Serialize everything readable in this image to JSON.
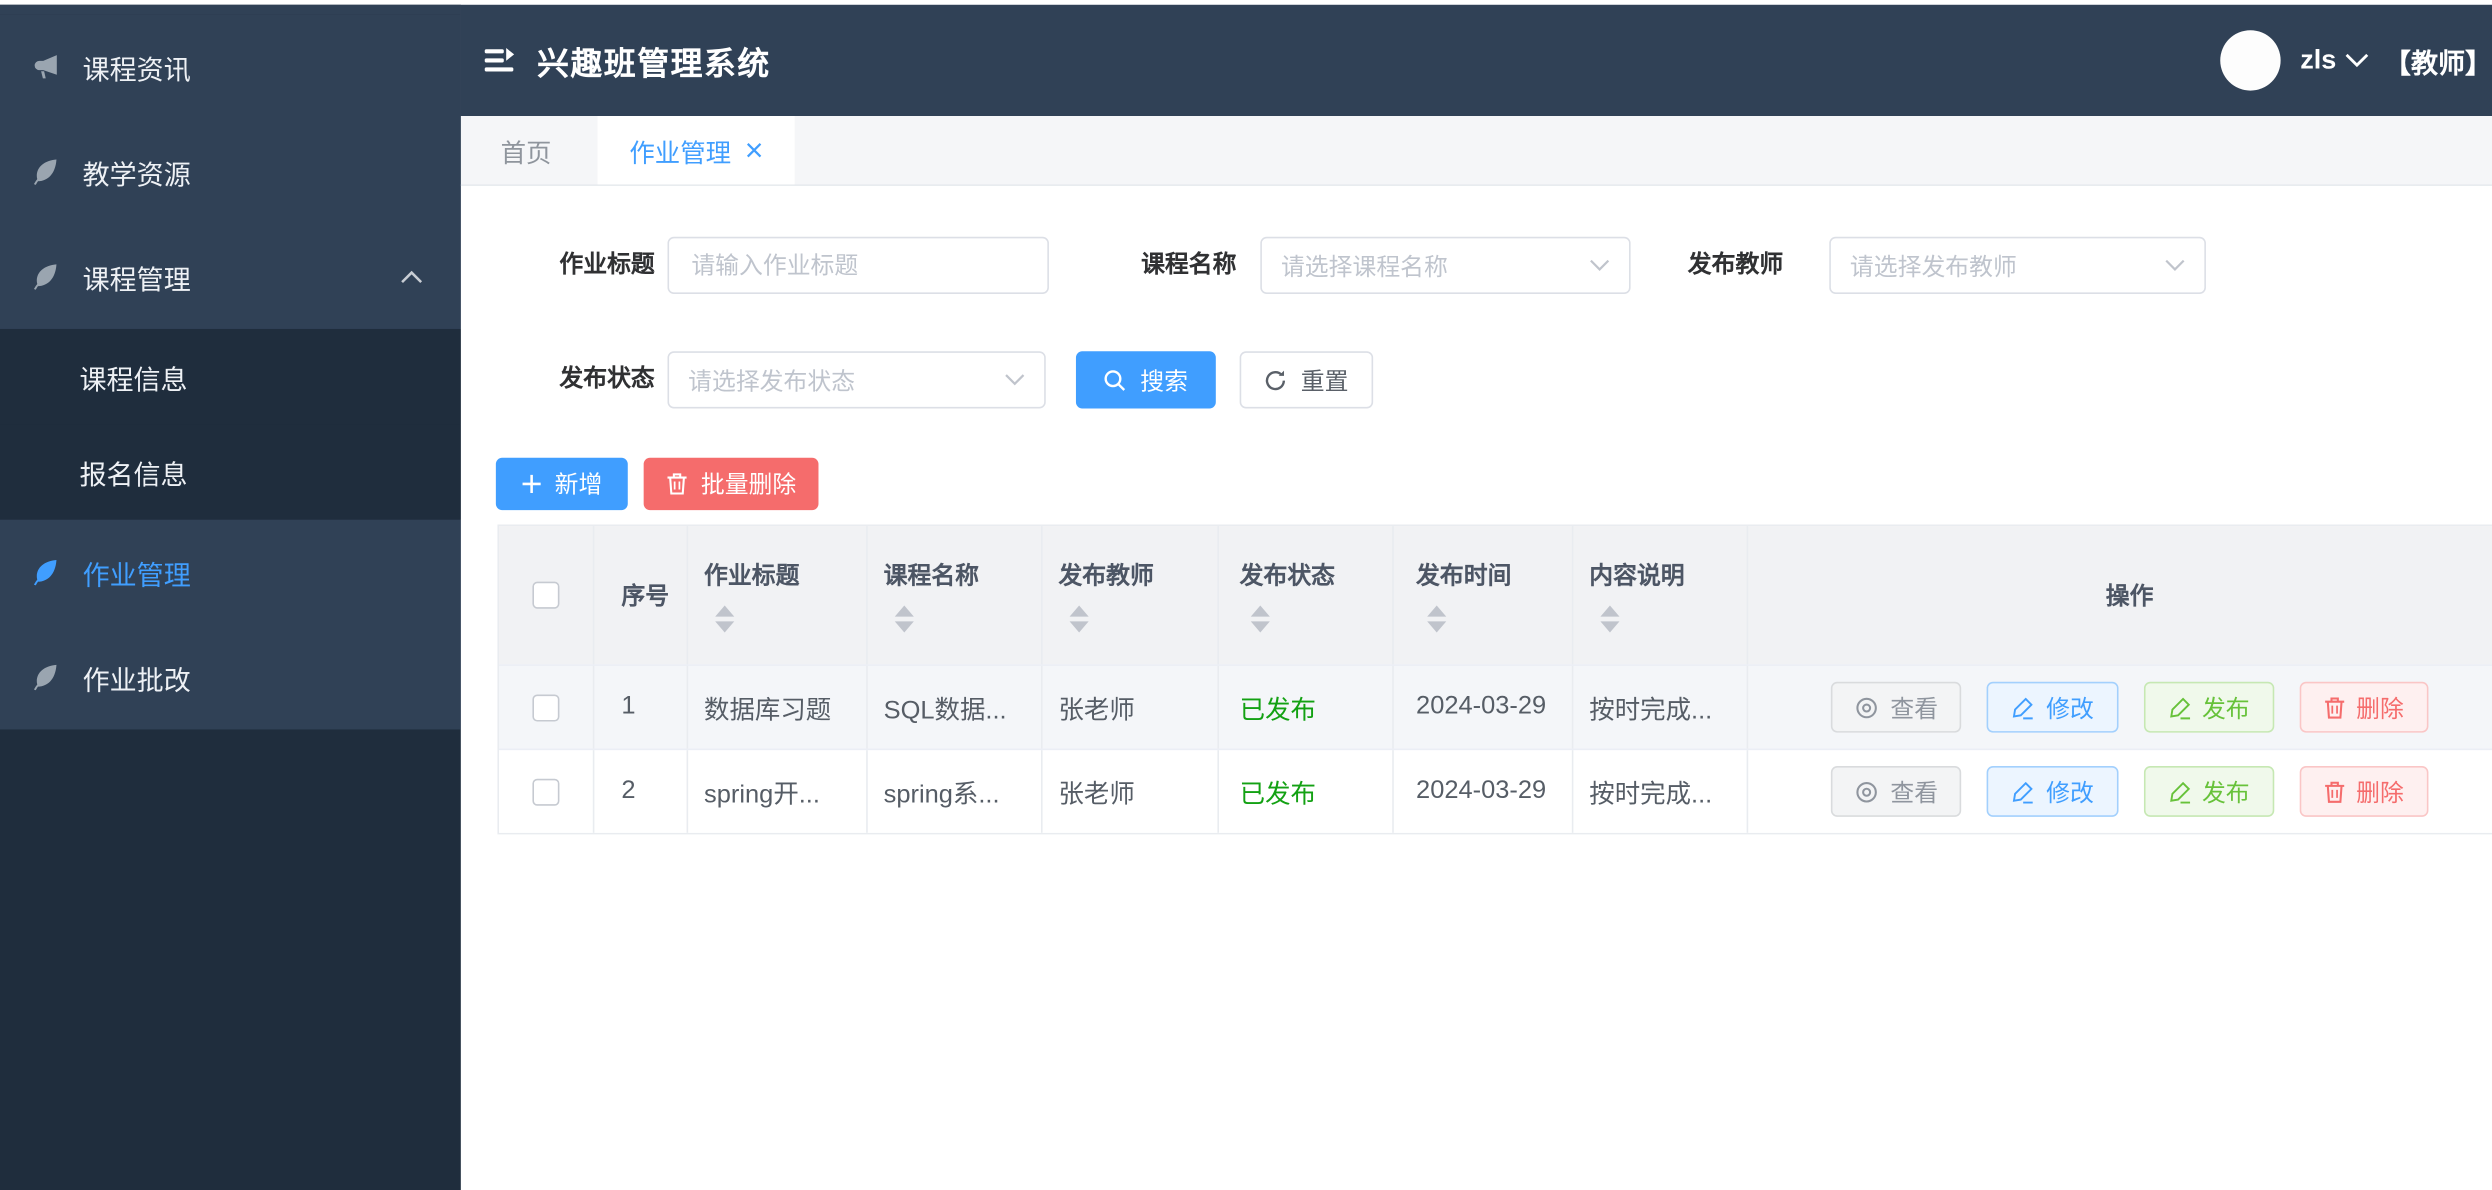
{
  "app": {
    "title": "兴趣班管理系统"
  },
  "header": {
    "username": "zls",
    "role_badge": "【教师】",
    "icons": [
      "hamburger-icon",
      "avatar",
      "chevron-down-icon"
    ]
  },
  "sidebar": {
    "items": [
      {
        "label": "课程资讯",
        "icon": "megaphone-icon",
        "active": false
      },
      {
        "label": "教学资源",
        "icon": "leaf-icon",
        "active": false
      },
      {
        "label": "课程管理",
        "icon": "leaf-icon",
        "active": false,
        "expanded": true,
        "children": [
          {
            "label": "课程信息"
          },
          {
            "label": "报名信息"
          }
        ]
      },
      {
        "label": "作业管理",
        "icon": "leaf-icon",
        "active": true
      },
      {
        "label": "作业批改",
        "icon": "leaf-icon",
        "active": false
      }
    ]
  },
  "tabs": [
    {
      "label": "首页",
      "active": false,
      "closable": false
    },
    {
      "label": "作业管理",
      "active": true,
      "closable": true
    }
  ],
  "filters": {
    "fields": [
      {
        "label": "作业标题",
        "placeholder": "请输入作业标题",
        "type": "input",
        "value": ""
      },
      {
        "label": "课程名称",
        "placeholder": "请选择课程名称",
        "type": "select",
        "value": ""
      },
      {
        "label": "发布教师",
        "placeholder": "请选择发布教师",
        "type": "select",
        "value": ""
      },
      {
        "label": "发布状态",
        "placeholder": "请选择发布状态",
        "type": "select",
        "value": ""
      }
    ],
    "search_label": "搜索",
    "reset_label": "重置"
  },
  "toolbar": {
    "add_label": "新增",
    "batch_delete_label": "批量删除"
  },
  "table": {
    "columns": [
      {
        "label": "序号",
        "sortable": false
      },
      {
        "label": "作业标题",
        "sortable": true
      },
      {
        "label": "课程名称",
        "sortable": true
      },
      {
        "label": "发布教师",
        "sortable": true
      },
      {
        "label": "发布状态",
        "sortable": true
      },
      {
        "label": "发布时间",
        "sortable": true
      },
      {
        "label": "内容说明",
        "sortable": true
      },
      {
        "label": "操作",
        "sortable": false
      }
    ],
    "rows": [
      {
        "index": "1",
        "title": "数据库习题",
        "course": "SQL数据...",
        "teacher": "张老师",
        "status": "已发布",
        "time": "2024-03-29",
        "desc": "按时完成...",
        "hovered": true
      },
      {
        "index": "2",
        "title": "spring开...",
        "course": "spring系...",
        "teacher": "张老师",
        "status": "已发布",
        "time": "2024-03-29",
        "desc": "按时完成...",
        "hovered": false
      }
    ],
    "row_actions": [
      {
        "label": "查看",
        "icon": "eye-icon"
      },
      {
        "label": "修改",
        "icon": "pen-icon"
      },
      {
        "label": "发布",
        "icon": "pen-icon"
      },
      {
        "label": "删除",
        "icon": "trash-icon"
      }
    ]
  },
  "colors": {
    "accent": "#409eff",
    "danger": "#f56c6c",
    "success_text": "#13a113",
    "header_bg": "#304156",
    "sidebar_dark_bg": "#1f2d3d",
    "table_header_bg": "#f1f2f4",
    "row_hover_bg": "#f4f6f9"
  }
}
